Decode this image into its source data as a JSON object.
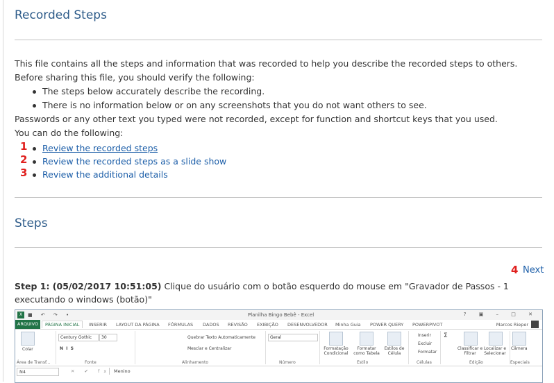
{
  "page": {
    "title": "Recorded Steps",
    "intro": "This file contains all the steps and information that was recorded to help you describe the recorded steps to others.",
    "before_sharing": "Before sharing this file, you should verify the following:",
    "checks": [
      "The steps below accurately describe the recording.",
      "There is no information below or on any screenshots that you do not want others to see."
    ],
    "passwords_note": "Passwords or any other text you typed were not recorded, except for function and shortcut keys that you used.",
    "you_can": "You can do the following:",
    "actions": [
      {
        "num": "1",
        "label": "Review the recorded steps"
      },
      {
        "num": "2",
        "label": "Review the recorded steps as a slide show"
      },
      {
        "num": "3",
        "label": "Review the additional details"
      }
    ]
  },
  "steps_section": {
    "title": "Steps",
    "next_num": "4",
    "next_label": "Next",
    "step1_header": "Step 1: (05/02/2017 10:51:05)",
    "step1_desc": "Clique do usuário com o botão esquerdo do mouse em \"Gravador de Passos - 1 executando o windows (botão)\""
  },
  "excel": {
    "window_title": "Planilha Bingo Bebê - Excel",
    "logo": "X",
    "quick_access": "■ ↶ ↷ •",
    "window_controls": "? ▣ – □ ✕",
    "tabs": [
      "ARQUIVO",
      "PÁGINA INICIAL",
      "INSERIR",
      "LAYOUT DA PÁGINA",
      "FÓRMULAS",
      "DADOS",
      "REVISÃO",
      "EXIBIÇÃO",
      "DESENVOLVEDOR",
      "Minha Guia",
      "POWER QUERY",
      "POWERPIVOT"
    ],
    "user": "Marcos Rieper",
    "ribbon": {
      "paste": "Colar",
      "clipboard": "Área de Transf...",
      "font_name": "Century Gothic",
      "font_size": "30",
      "font_group": "Fonte",
      "wrap": "Quebrar Texto Automaticamente",
      "merge": "Mesclar e Centralizar",
      "alignment": "Alinhamento",
      "number_format": "Geral",
      "number": "Número",
      "cond_format": "Formatação Condicional",
      "format_table": "Formatar como Tabela",
      "cell_styles": "Estilos de Célula",
      "styles": "Estilo",
      "insert": "Inserir",
      "delete": "Excluir",
      "format": "Formatar",
      "cells": "Células",
      "sort": "Classificar e Filtrar",
      "find": "Localizar e Selecionar",
      "editing": "Edição",
      "camera": "Câmera",
      "special": "Especiais"
    },
    "name_box": "N4",
    "formula_icons": "✕ ✔ fx",
    "formula_value": "Menino"
  }
}
